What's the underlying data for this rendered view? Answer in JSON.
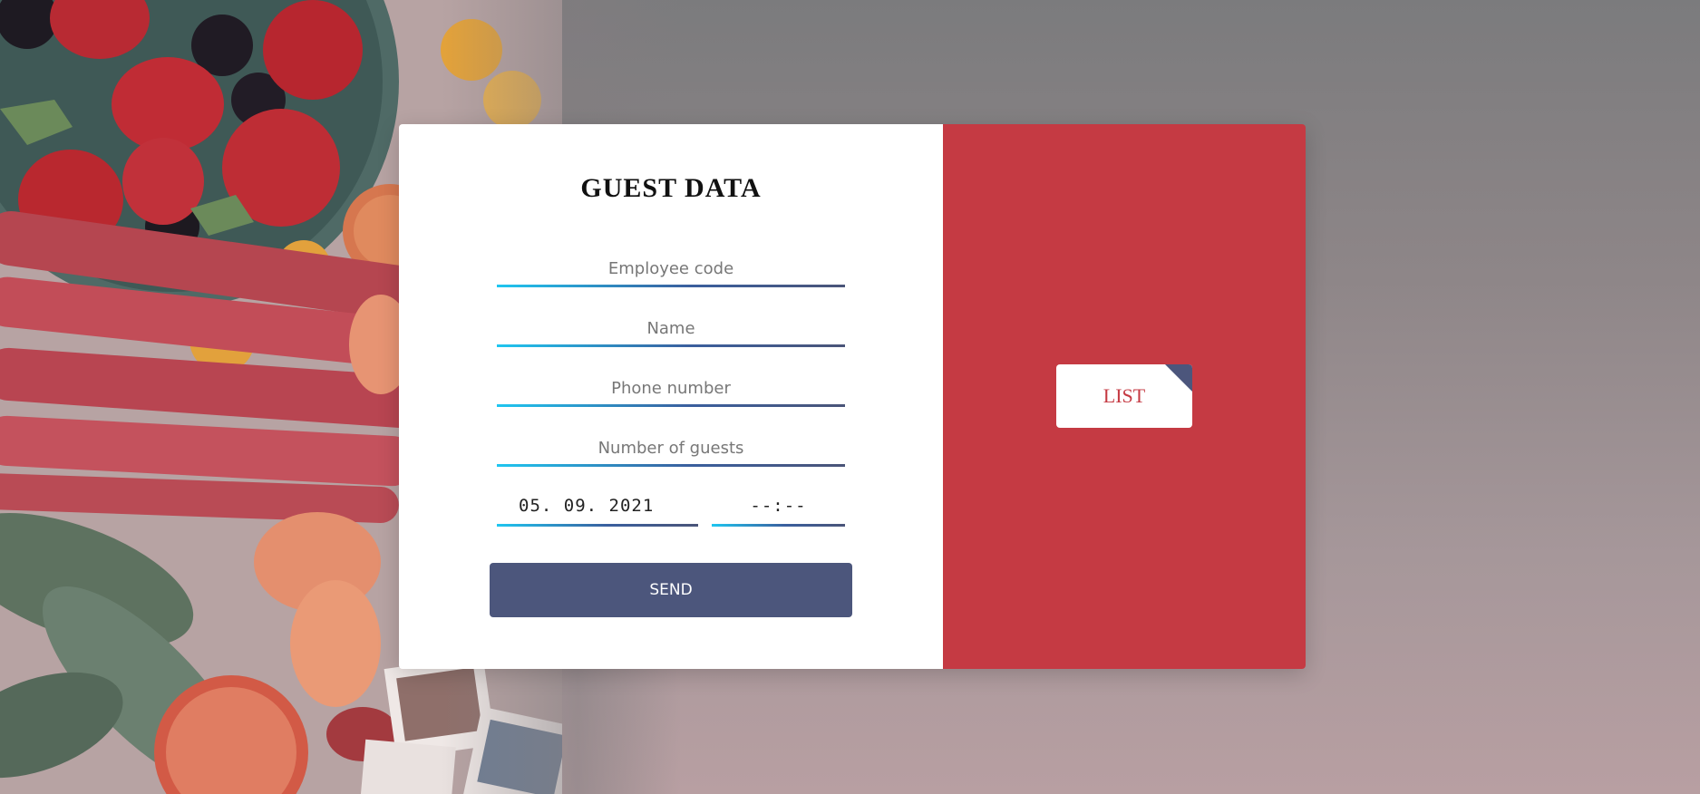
{
  "form": {
    "title": "GUEST DATA",
    "fields": {
      "employee_code": {
        "placeholder": "Employee code",
        "value": ""
      },
      "name": {
        "placeholder": "Name",
        "value": ""
      },
      "phone": {
        "placeholder": "Phone number",
        "value": ""
      },
      "guests": {
        "placeholder": "Number of guests",
        "value": ""
      }
    },
    "date": {
      "value": "05. 09. 2021"
    },
    "time": {
      "value": "--:--"
    },
    "send_label": "SEND"
  },
  "list_panel": {
    "button_label": "LIST"
  },
  "colors": {
    "panel_red": "#c53a43",
    "button_navy": "#4c567c",
    "underline_start": "#1fc6f0",
    "underline_end": "#4a5478"
  }
}
